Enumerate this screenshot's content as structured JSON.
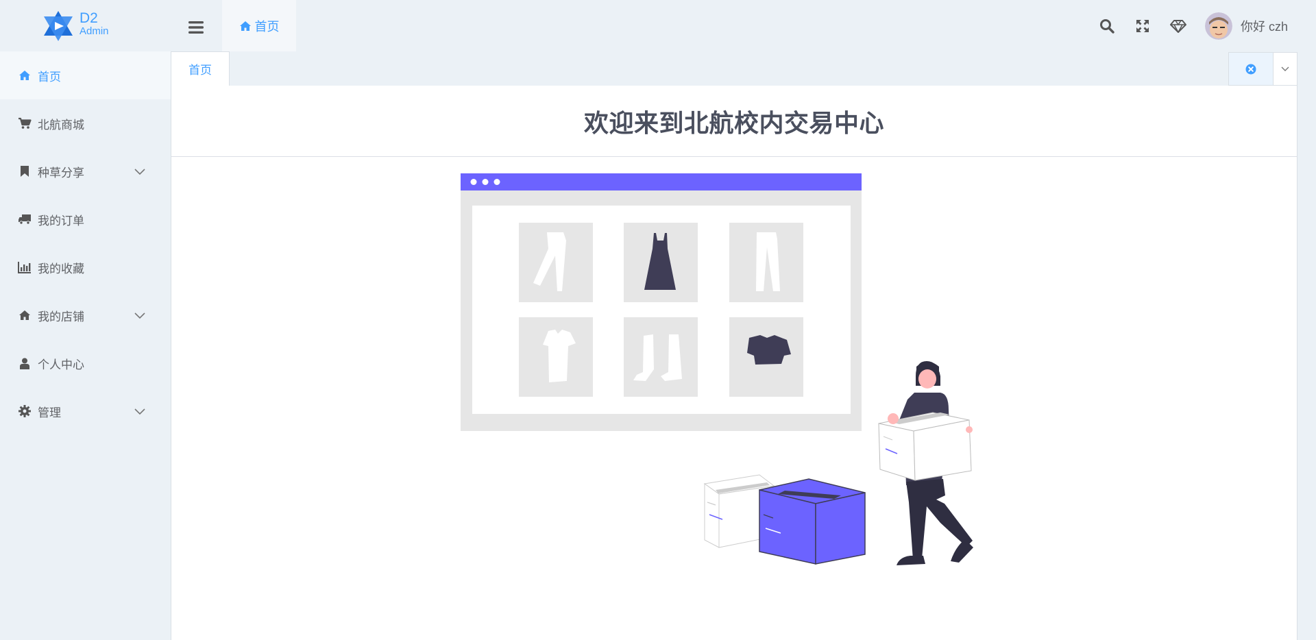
{
  "brand": {
    "name": "D2",
    "sub": "Admin"
  },
  "header": {
    "home_tab": "首页",
    "user_greeting": "你好 czh",
    "icons": [
      "menu-icon",
      "search-icon",
      "fullscreen-icon",
      "diamond-icon"
    ]
  },
  "sidebar": {
    "items": [
      {
        "label": "首页",
        "icon": "home-icon",
        "active": true,
        "has_children": false
      },
      {
        "label": "北航商城",
        "icon": "cart-icon",
        "has_children": false
      },
      {
        "label": "种草分享",
        "icon": "bookmark-icon",
        "has_children": true
      },
      {
        "label": "我的订单",
        "icon": "truck-icon",
        "has_children": false
      },
      {
        "label": "我的收藏",
        "icon": "bar-chart-icon",
        "has_children": false
      },
      {
        "label": "我的店铺",
        "icon": "home-icon",
        "has_children": true
      },
      {
        "label": "个人中心",
        "icon": "user-icon",
        "has_children": false
      },
      {
        "label": "管理",
        "icon": "gear-icon",
        "has_children": true
      }
    ]
  },
  "tabs": {
    "items": [
      {
        "label": "首页",
        "active": true
      }
    ]
  },
  "main": {
    "welcome": "欢迎来到北航校内交易中心"
  },
  "colors": {
    "accent": "#409eff",
    "illustration_purple": "#6c63ff",
    "dark": "#3f3d56",
    "bg": "#ebf1f6"
  }
}
